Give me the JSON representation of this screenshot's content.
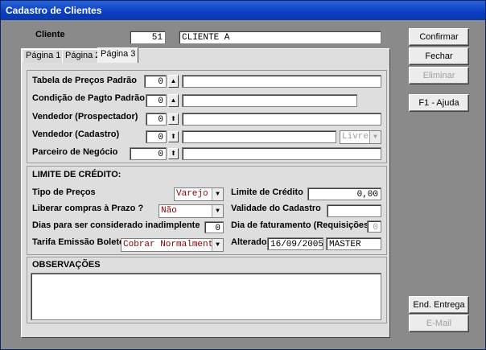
{
  "window": {
    "title": "Cadastro de Clientes"
  },
  "header": {
    "cliente_label": "Cliente",
    "cliente_code": "51",
    "cliente_name": "CLIENTE A"
  },
  "tabs": [
    {
      "label": "Página 1"
    },
    {
      "label": "Página 2"
    },
    {
      "label": "Página 3"
    }
  ],
  "buttons": {
    "confirmar": "Confirmar",
    "fechar": "Fechar",
    "eliminar": "Eliminar",
    "ajuda": "F1 - Ajuda",
    "end_entrega": "End. Entrega",
    "email": "E-Mail"
  },
  "fields": {
    "tabela_precos": {
      "label": "Tabela de Preços Padrão",
      "value": "0"
    },
    "condicao_pagto": {
      "label": "Condição de Pagto Padrão",
      "value": "0"
    },
    "vendedor_prospectador": {
      "label": "Vendedor (Prospectador)",
      "value": "0"
    },
    "vendedor_cadastro": {
      "label": "Vendedor (Cadastro)",
      "value": "0",
      "status": "Livre"
    },
    "parceiro_negocio": {
      "label": "Parceiro de Negócio",
      "value": "0"
    }
  },
  "credito": {
    "section_title": "LIMITE DE CRÉDITO:",
    "tipo_precos_label": "Tipo de Preços",
    "tipo_precos_value": "Varejo",
    "limite_credito_label": "Limite de Crédito",
    "limite_credito_value": "0,00",
    "liberar_compras_label": "Liberar compras à Prazo ?",
    "liberar_compras_value": "Não",
    "validade_label": "Validade do Cadastro",
    "validade_value": "",
    "dias_inadimplente_label": "Dias para ser considerado inadimplente",
    "dias_inadimplente_value": "0",
    "dia_faturamento_label": "Dia de faturamento (Requisições)",
    "dia_faturamento_value": "0",
    "tarifa_boleto_label": "Tarifa Emissão Boleto",
    "tarifa_boleto_value": "Cobrar Normalmente",
    "alterado_label": "Alterado",
    "alterado_date": "16/09/2005",
    "alterado_user": "MASTER"
  },
  "observacoes": {
    "title": "OBSERVAÇÕES",
    "text": ""
  }
}
